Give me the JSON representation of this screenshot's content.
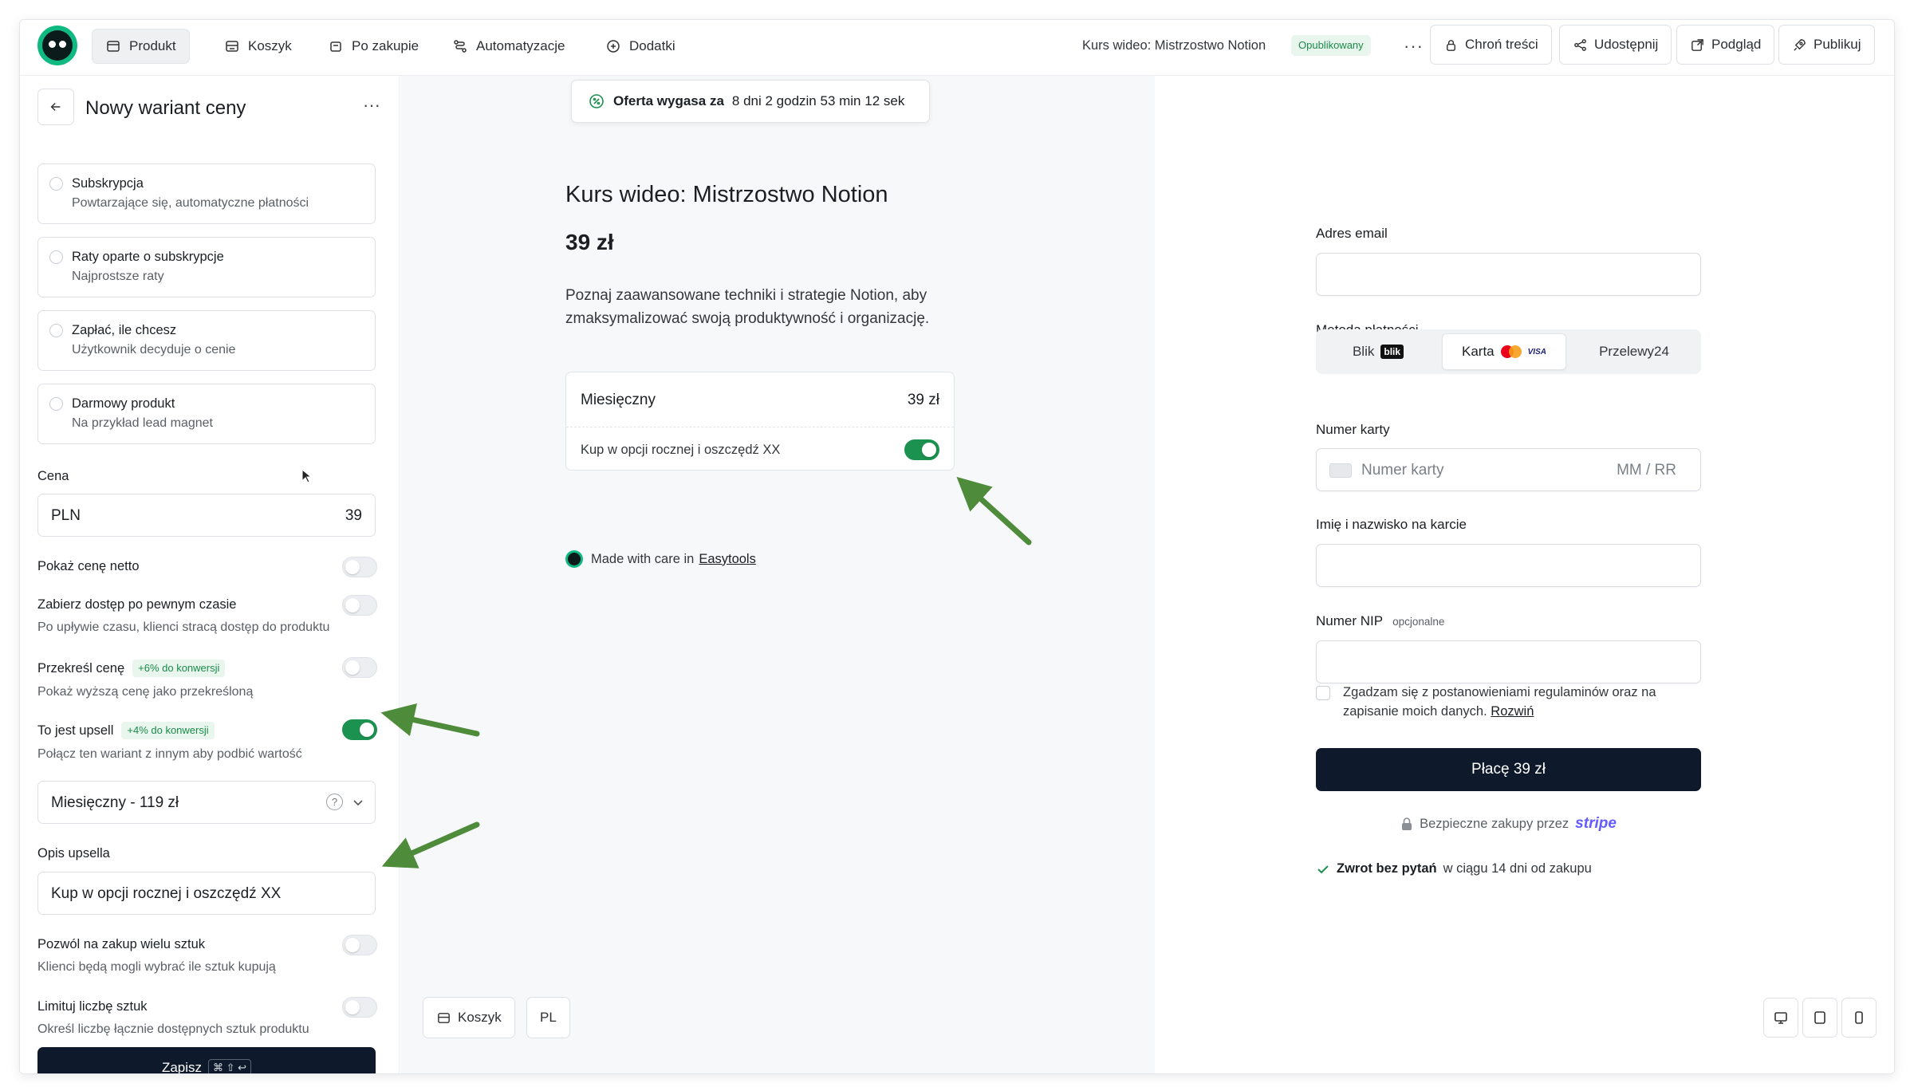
{
  "colors": {
    "accent": "#1c9250",
    "brand": "#10b981",
    "dark_button": "#0e1a2b",
    "stripe": "#635bff"
  },
  "topbar": {
    "tabs": [
      {
        "label": "Produkt",
        "icon": "box-icon"
      },
      {
        "label": "Koszyk",
        "icon": "cart-icon"
      },
      {
        "label": "Po zakupie",
        "icon": "bag-icon"
      },
      {
        "label": "Automatyzacje",
        "icon": "flow-icon"
      },
      {
        "label": "Dodatki",
        "icon": "puzzle-icon"
      }
    ],
    "product_title": "Kurs wideo: Mistrzostwo Notion",
    "status": "Opublikowany",
    "protect": "Chroń treści",
    "share": "Udostępnij",
    "preview": "Podgląd",
    "publish": "Publikuj"
  },
  "left": {
    "title": "Nowy wariant ceny",
    "options": [
      {
        "title": "Subskrypcja",
        "subtitle": "Powtarzające się, automatyczne płatności"
      },
      {
        "title": "Raty oparte o subskrypcje",
        "subtitle": "Najprostsze raty"
      },
      {
        "title": "Zapłać, ile chcesz",
        "subtitle": "Użytkownik decyduje o cenie"
      },
      {
        "title": "Darmowy produkt",
        "subtitle": "Na przykład lead magnet"
      }
    ],
    "price_label": "Cena",
    "currency": "PLN",
    "price_value": "39",
    "toggles": [
      {
        "title": "Pokaż cenę netto",
        "subtitle": "",
        "badge": "",
        "on": false
      },
      {
        "title": "Zabierz dostęp po pewnym czasie",
        "subtitle": "Po upływie czasu, klienci stracą dostęp do produktu",
        "badge": "",
        "on": false
      },
      {
        "title": "Przekreśl cenę",
        "subtitle": "Pokaż wyższą cenę jako przekreśloną",
        "badge": "+6% do konwersji",
        "on": false
      },
      {
        "title": "To jest upsell",
        "subtitle": "Połącz ten wariant z innym aby podbić wartość",
        "badge": "+4% do konwersji",
        "on": true
      }
    ],
    "upsell_select": "Miesięczny - 119 zł",
    "upsell_desc_label": "Opis upsella",
    "upsell_desc_value": "Kup w opcji rocznej i oszczędź XX",
    "toggles2": [
      {
        "title": "Pozwól na zakup wielu sztuk",
        "subtitle": "Klienci będą mogli wybrać ile sztuk kupują",
        "on": false
      },
      {
        "title": "Limituj liczbę sztuk",
        "subtitle": "Określ liczbę łącznie dostępnych sztuk produktu",
        "on": false
      }
    ],
    "save_label": "Zapisz",
    "save_shortcut": "⌘ ⇧ ↩"
  },
  "middle": {
    "timer_label": "Oferta wygasa za",
    "timer_value": "8 dni 2 godzin 53 min 12 sek",
    "title": "Kurs wideo: Mistrzostwo Notion",
    "price": "39 zł",
    "description": "Poznaj zaawansowane techniki i strategie Notion, aby zmaksymalizować swoją produktywność i organizację.",
    "variant_name": "Miesięczny",
    "variant_price": "39 zł",
    "upsell_text": "Kup w opcji rocznej i oszczędź XX",
    "made_with": "Made with care in",
    "made_with_link": "Easytools",
    "cart_button": "Koszyk",
    "lang_button": "PL"
  },
  "right": {
    "email_label": "Adres email",
    "method_label": "Metoda płatności",
    "methods": [
      {
        "label": "Blik",
        "mark": "blik"
      },
      {
        "label": "Karta"
      },
      {
        "label": "Przelewy24"
      }
    ],
    "visa_label": "VISA",
    "card_label": "Numer karty",
    "card_placeholder": "Numer karty",
    "expiry_placeholder": "MM / RR",
    "name_label": "Imię i nazwisko na karcie",
    "nip_label": "Numer NIP",
    "nip_optional": "opcjonalne",
    "terms_text": "Zgadzam się z postanowieniami regulaminów oraz na zapisanie moich danych.",
    "terms_link": "Rozwiń",
    "pay_button": "Płacę 39 zł",
    "secure_text": "Bezpieczne zakupy przez",
    "secure_brand": "stripe",
    "refund_bold": "Zwrot bez pytań",
    "refund_rest": "w ciągu 14 dni od zakupu"
  }
}
